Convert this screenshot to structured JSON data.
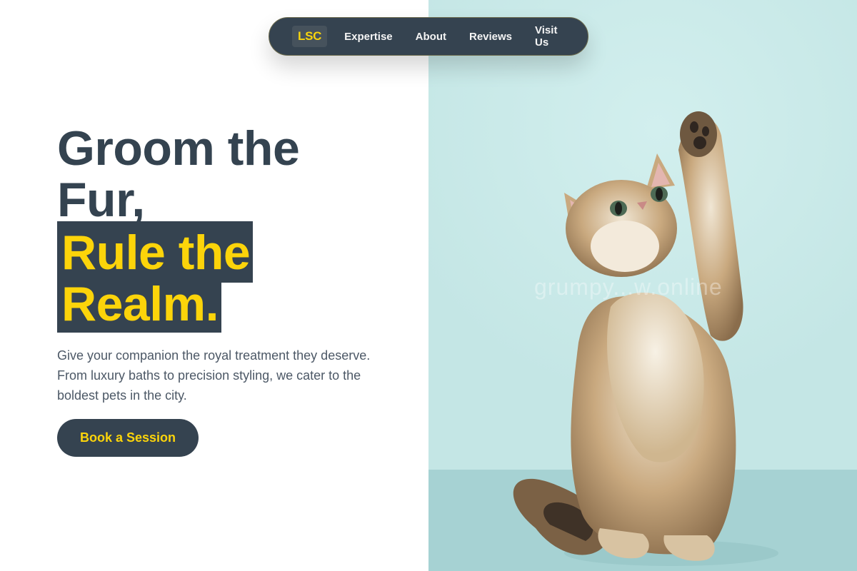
{
  "nav": {
    "logo": "LSC",
    "links": [
      "Expertise",
      "About",
      "Reviews",
      "Visit Us"
    ]
  },
  "hero": {
    "headline_line1": "Groom the",
    "headline_line2": "Fur,",
    "highlight_line1": "Rule the",
    "highlight_line2": "Realm.",
    "subtext": "Give your companion the royal treatment they deserve. From luxury baths to precision styling, we cater to the boldest pets in the city.",
    "cta_label": "Book a Session"
  },
  "image": {
    "subject": "kitten-raising-paw",
    "watermark": "grumpy...w.online"
  },
  "colors": {
    "navy": "#354350",
    "accent_yellow": "#fcd40a",
    "image_background": "#c4e6e5"
  }
}
